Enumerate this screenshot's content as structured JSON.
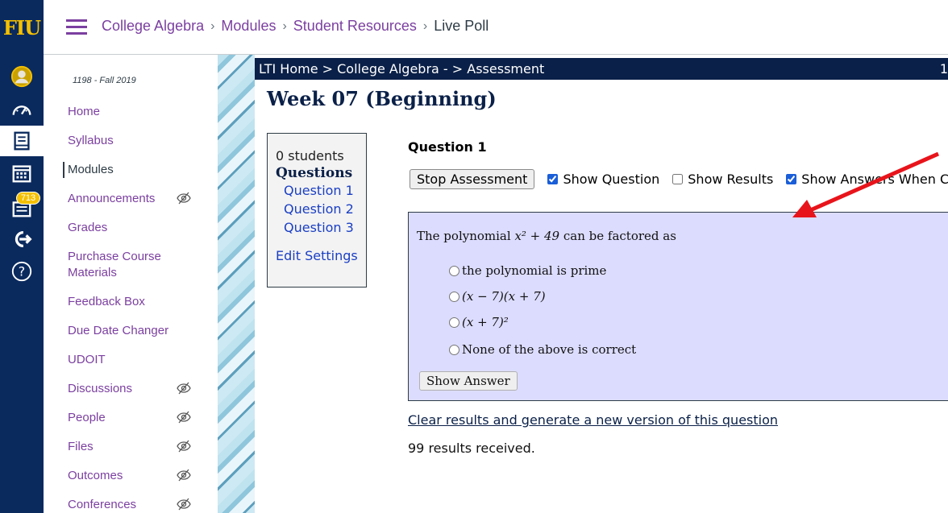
{
  "global_nav": {
    "logo": "FIU",
    "inbox_badge": "713",
    "icons": [
      "account-icon",
      "dashboard-icon",
      "courses-icon",
      "calendar-icon",
      "inbox-icon",
      "commons-icon",
      "help-icon"
    ]
  },
  "header": {
    "breadcrumb": [
      "College Algebra",
      "Modules",
      "Student Resources",
      "Live Poll"
    ]
  },
  "course_nav": {
    "term": "1198 - Fall 2019",
    "items": [
      {
        "label": "Home",
        "hidden": false
      },
      {
        "label": "Syllabus",
        "hidden": false
      },
      {
        "label": "Modules",
        "hidden": false,
        "active": true
      },
      {
        "label": "Announcements",
        "hidden": true
      },
      {
        "label": "Grades",
        "hidden": false
      },
      {
        "label": "Purchase Course Materials",
        "hidden": false
      },
      {
        "label": "Feedback Box",
        "hidden": false
      },
      {
        "label": "Due Date Changer",
        "hidden": false
      },
      {
        "label": "UDOIT",
        "hidden": false
      },
      {
        "label": "Discussions",
        "hidden": true
      },
      {
        "label": "People",
        "hidden": true
      },
      {
        "label": "Files",
        "hidden": true
      },
      {
        "label": "Outcomes",
        "hidden": true
      },
      {
        "label": "Conferences",
        "hidden": true
      }
    ]
  },
  "lti": {
    "breadcrumb": "LTI Home > College Algebra - > Assessment",
    "breadcrumb_right": "1",
    "title": "Week 07 (Beginning)",
    "sidebar": {
      "students": "0 students",
      "questions_heading": "Questions",
      "questions": [
        "Question 1",
        "Question 2",
        "Question 3"
      ],
      "edit_settings": "Edit Settings"
    },
    "question_title": "Question 1",
    "controls": {
      "stop_button": "Stop Assessment",
      "show_question": "Show Question",
      "show_question_checked": true,
      "show_results": "Show Results",
      "show_results_checked": false,
      "show_answers": "Show Answers When C",
      "show_answers_checked": true
    },
    "question": {
      "prompt_before": "The polynomial ",
      "prompt_math": "x² + 49",
      "prompt_after": " can be factored as",
      "choices": [
        "the polynomial is prime",
        "(x − 7)(x + 7)",
        "(x + 7)²",
        "None of the above is correct"
      ],
      "show_answer_button": "Show Answer"
    },
    "clear_link": "Clear results and generate a new version of this question",
    "results": "99 results received."
  },
  "colors": {
    "global_nav_bg": "#0a2a5e",
    "logo": "#f5c000",
    "link_purple": "#7b3fa0",
    "lti_bar": "#0a2048",
    "question_panel": "#dcdcff",
    "annotation_arrow": "#e8141b"
  }
}
